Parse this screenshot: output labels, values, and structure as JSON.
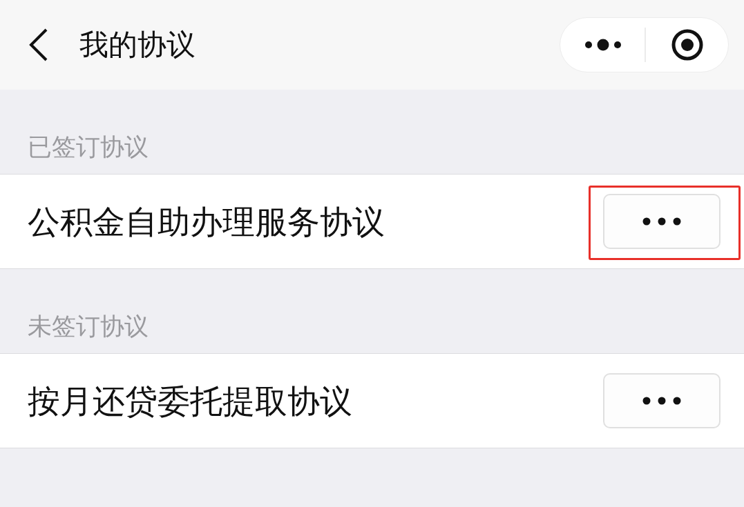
{
  "nav_bar": {
    "title": "我的协议"
  },
  "sections": [
    {
      "heading": "已签订协议",
      "items": [
        {
          "title": "公积金自助办理服务协议",
          "highlighted": true
        }
      ]
    },
    {
      "heading": "未签订协议",
      "items": [
        {
          "title": "按月还贷委托提取协议",
          "highlighted": false
        }
      ]
    }
  ]
}
